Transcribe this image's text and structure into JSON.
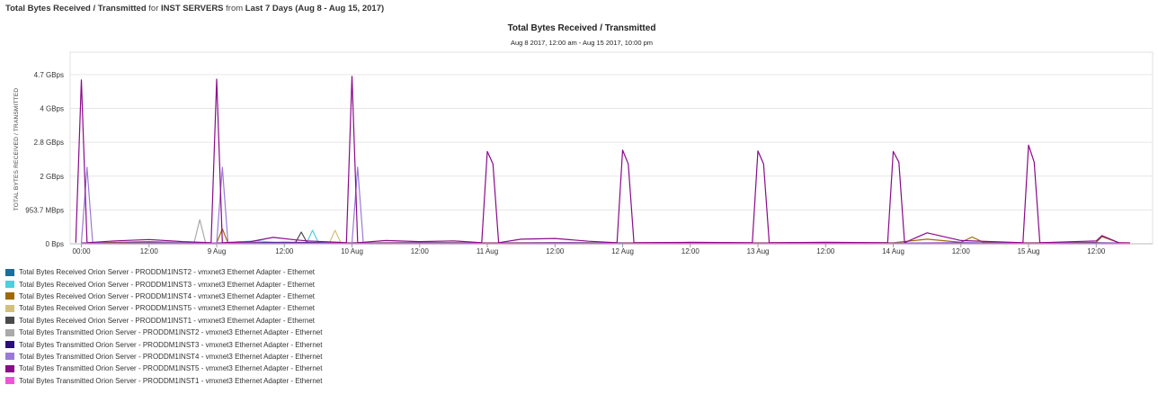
{
  "header": {
    "title": "Total Bytes Received / Transmitted",
    "for_word": "for",
    "group": "INST SERVERS",
    "from_word": "from",
    "range": "Last 7 Days (Aug 8 - Aug 15, 2017)"
  },
  "chart_data": {
    "type": "line",
    "title": "Total Bytes Received / Transmitted",
    "subtitle": "Aug 8 2017, 12:00 am - Aug 15 2017, 10:00 pm",
    "ylabel": "TOTAL BYTES RECEIVED / TRANSMITTED",
    "y_ticks": [
      {
        "value": 0,
        "label": "0 Bps"
      },
      {
        "value": 953.7,
        "label": "953.7 MBps"
      },
      {
        "value": 1907.3,
        "label": "2 GBps"
      },
      {
        "value": 2861,
        "label": "2.8 GBps"
      },
      {
        "value": 3814.7,
        "label": "4 GBps"
      },
      {
        "value": 4768.4,
        "label": "4.7 GBps"
      }
    ],
    "ylim": [
      0,
      5400
    ],
    "y_unit": "MBps",
    "x_range_hours": [
      -2,
      190
    ],
    "x_ticks": [
      {
        "hour": 0,
        "label": "00:00"
      },
      {
        "hour": 12,
        "label": "12:00"
      },
      {
        "hour": 24,
        "label": "9 Aug"
      },
      {
        "hour": 36,
        "label": "12:00"
      },
      {
        "hour": 48,
        "label": "10 Aug"
      },
      {
        "hour": 60,
        "label": "12:00"
      },
      {
        "hour": 72,
        "label": "11 Aug"
      },
      {
        "hour": 84,
        "label": "12:00"
      },
      {
        "hour": 96,
        "label": "12 Aug"
      },
      {
        "hour": 108,
        "label": "12:00"
      },
      {
        "hour": 120,
        "label": "13 Aug"
      },
      {
        "hour": 132,
        "label": "12:00"
      },
      {
        "hour": 144,
        "label": "14 Aug"
      },
      {
        "hour": 156,
        "label": "12:00"
      },
      {
        "hour": 168,
        "label": "15 Aug"
      },
      {
        "hour": 180,
        "label": "12:00"
      }
    ],
    "grid": "horizontal",
    "legend_position": "bottom",
    "series": [
      {
        "name": "Total Bytes Received Orion Server - PRODDM1INST2 - vmxnet3 Ethernet Adapter - Ethernet",
        "color": "#1a6e9e",
        "points": [
          [
            0,
            20
          ],
          [
            12,
            20
          ],
          [
            24,
            10
          ],
          [
            36,
            20
          ],
          [
            48,
            10
          ],
          [
            60,
            20
          ],
          [
            72,
            10
          ],
          [
            84,
            20
          ],
          [
            96,
            10
          ],
          [
            108,
            20
          ],
          [
            120,
            10
          ],
          [
            132,
            20
          ],
          [
            144,
            10
          ],
          [
            156,
            20
          ],
          [
            168,
            10
          ],
          [
            180,
            20
          ],
          [
            186,
            10
          ]
        ]
      },
      {
        "name": "Total Bytes Received Orion Server - PRODDM1INST3 - vmxnet3 Ethernet Adapter - Ethernet",
        "color": "#4dcfe0",
        "points": [
          [
            0,
            10
          ],
          [
            12,
            20
          ],
          [
            24,
            20
          ],
          [
            31,
            80
          ],
          [
            36,
            20
          ],
          [
            40,
            40
          ],
          [
            41,
            380
          ],
          [
            42,
            40
          ],
          [
            48,
            20
          ],
          [
            60,
            20
          ],
          [
            72,
            20
          ],
          [
            84,
            20
          ],
          [
            96,
            20
          ],
          [
            108,
            20
          ],
          [
            120,
            20
          ],
          [
            132,
            20
          ],
          [
            144,
            20
          ],
          [
            156,
            20
          ],
          [
            168,
            20
          ],
          [
            180,
            20
          ],
          [
            186,
            20
          ]
        ]
      },
      {
        "name": "Total Bytes Received Orion Server - PRODDM1INST4 - vmxnet3 Ethernet Adapter - Ethernet",
        "color": "#a06a00",
        "points": [
          [
            0,
            20
          ],
          [
            12,
            60
          ],
          [
            20,
            20
          ],
          [
            24,
            20
          ],
          [
            25,
            420
          ],
          [
            26,
            20
          ],
          [
            36,
            30
          ],
          [
            48,
            30
          ],
          [
            60,
            30
          ],
          [
            72,
            30
          ],
          [
            84,
            30
          ],
          [
            96,
            30
          ],
          [
            108,
            30
          ],
          [
            120,
            30
          ],
          [
            132,
            30
          ],
          [
            144,
            30
          ],
          [
            150,
            130
          ],
          [
            156,
            40
          ],
          [
            158,
            190
          ],
          [
            160,
            40
          ],
          [
            168,
            30
          ],
          [
            180,
            40
          ],
          [
            181,
            200
          ],
          [
            184,
            30
          ],
          [
            186,
            30
          ]
        ]
      },
      {
        "name": "Total Bytes Received Orion Server - PRODDM1INST5 - vmxnet3 Ethernet Adapter - Ethernet",
        "color": "#d4c07a",
        "points": [
          [
            0,
            10
          ],
          [
            12,
            20
          ],
          [
            24,
            10
          ],
          [
            28,
            60
          ],
          [
            36,
            20
          ],
          [
            44,
            30
          ],
          [
            45,
            380
          ],
          [
            46,
            30
          ],
          [
            48,
            20
          ],
          [
            60,
            20
          ],
          [
            72,
            20
          ],
          [
            84,
            20
          ],
          [
            96,
            20
          ],
          [
            108,
            20
          ],
          [
            120,
            20
          ],
          [
            132,
            20
          ],
          [
            144,
            20
          ],
          [
            156,
            20
          ],
          [
            168,
            20
          ],
          [
            180,
            20
          ],
          [
            186,
            10
          ]
        ]
      },
      {
        "name": "Total Bytes Received Orion Server - PRODDM1INST1 - vmxnet3 Ethernet Adapter - Ethernet",
        "color": "#4a4a4a",
        "points": [
          [
            0,
            10
          ],
          [
            12,
            10
          ],
          [
            24,
            10
          ],
          [
            36,
            10
          ],
          [
            38,
            40
          ],
          [
            39,
            330
          ],
          [
            40,
            40
          ],
          [
            48,
            10
          ],
          [
            60,
            10
          ],
          [
            72,
            10
          ],
          [
            84,
            10
          ],
          [
            96,
            10
          ],
          [
            108,
            10
          ],
          [
            120,
            10
          ],
          [
            132,
            10
          ],
          [
            144,
            10
          ],
          [
            156,
            10
          ],
          [
            168,
            10
          ],
          [
            180,
            10
          ],
          [
            186,
            10
          ]
        ]
      },
      {
        "name": "Total Bytes Transmitted Orion Server - PRODDM1INST2 - vmxnet3 Ethernet Adapter - Ethernet",
        "color": "#aaaaaa",
        "points": [
          [
            0,
            10
          ],
          [
            12,
            30
          ],
          [
            20,
            40
          ],
          [
            21,
            680
          ],
          [
            22,
            40
          ],
          [
            24,
            10
          ],
          [
            36,
            20
          ],
          [
            48,
            10
          ],
          [
            60,
            20
          ],
          [
            72,
            10
          ],
          [
            84,
            20
          ],
          [
            96,
            10
          ],
          [
            108,
            20
          ],
          [
            120,
            10
          ],
          [
            132,
            20
          ],
          [
            144,
            10
          ],
          [
            156,
            20
          ],
          [
            168,
            10
          ],
          [
            180,
            20
          ],
          [
            186,
            10
          ]
        ]
      },
      {
        "name": "Total Bytes Transmitted Orion Server - PRODDM1INST3 - vmxnet3 Ethernet Adapter - Ethernet",
        "color": "#2a0f78",
        "points": [
          [
            0,
            20
          ],
          [
            12,
            30
          ],
          [
            24,
            20
          ],
          [
            36,
            40
          ],
          [
            48,
            20
          ],
          [
            60,
            30
          ],
          [
            72,
            20
          ],
          [
            84,
            30
          ],
          [
            96,
            20
          ],
          [
            108,
            30
          ],
          [
            120,
            20
          ],
          [
            132,
            30
          ],
          [
            144,
            20
          ],
          [
            156,
            30
          ],
          [
            168,
            20
          ],
          [
            180,
            30
          ],
          [
            186,
            20
          ]
        ]
      },
      {
        "name": "Total Bytes Transmitted Orion Server - PRODDM1INST4 - vmxnet3 Ethernet Adapter - Ethernet",
        "color": "#9a7ad8",
        "points": [
          [
            0,
            20
          ],
          [
            1,
            2160
          ],
          [
            2,
            20
          ],
          [
            12,
            20
          ],
          [
            24,
            20
          ],
          [
            25,
            2160
          ],
          [
            26,
            20
          ],
          [
            36,
            20
          ],
          [
            48,
            20
          ],
          [
            49,
            2160
          ],
          [
            50,
            20
          ],
          [
            60,
            20
          ],
          [
            72,
            20
          ],
          [
            84,
            20
          ],
          [
            96,
            20
          ],
          [
            108,
            20
          ],
          [
            120,
            20
          ],
          [
            132,
            20
          ],
          [
            144,
            20
          ],
          [
            156,
            20
          ],
          [
            168,
            20
          ],
          [
            180,
            20
          ],
          [
            186,
            20
          ]
        ]
      },
      {
        "name": "Total Bytes Transmitted Orion Server - PRODDM1INST5 - vmxnet3 Ethernet Adapter - Ethernet",
        "color": "#8a0a8a",
        "points": [
          [
            -1,
            30
          ],
          [
            0,
            4620
          ],
          [
            1,
            30
          ],
          [
            6,
            80
          ],
          [
            12,
            120
          ],
          [
            18,
            60
          ],
          [
            23,
            30
          ],
          [
            24,
            4640
          ],
          [
            25,
            30
          ],
          [
            30,
            60
          ],
          [
            34,
            180
          ],
          [
            38,
            110
          ],
          [
            40,
            80
          ],
          [
            47,
            30
          ],
          [
            48,
            4720
          ],
          [
            49,
            30
          ],
          [
            54,
            90
          ],
          [
            60,
            60
          ],
          [
            66,
            80
          ],
          [
            71,
            30
          ],
          [
            72,
            2600
          ],
          [
            73,
            2250
          ],
          [
            74,
            30
          ],
          [
            78,
            130
          ],
          [
            84,
            150
          ],
          [
            90,
            70
          ],
          [
            95,
            30
          ],
          [
            96,
            2640
          ],
          [
            97,
            2250
          ],
          [
            98,
            30
          ],
          [
            108,
            40
          ],
          [
            119,
            30
          ],
          [
            120,
            2620
          ],
          [
            121,
            2250
          ],
          [
            122,
            30
          ],
          [
            132,
            40
          ],
          [
            143,
            30
          ],
          [
            144,
            2600
          ],
          [
            145,
            2300
          ],
          [
            146,
            30
          ],
          [
            150,
            310
          ],
          [
            156,
            90
          ],
          [
            167,
            30
          ],
          [
            168,
            2780
          ],
          [
            169,
            2300
          ],
          [
            170,
            30
          ],
          [
            180,
            80
          ],
          [
            181,
            230
          ],
          [
            184,
            30
          ],
          [
            186,
            20
          ]
        ]
      },
      {
        "name": "Total Bytes Transmitted Orion Server - PRODDM1INST1 - vmxnet3 Ethernet Adapter - Ethernet",
        "color": "#ee55d6",
        "points": [
          [
            0,
            10
          ],
          [
            12,
            10
          ],
          [
            24,
            10
          ],
          [
            36,
            10
          ],
          [
            48,
            10
          ],
          [
            60,
            10
          ],
          [
            72,
            10
          ],
          [
            84,
            10
          ],
          [
            96,
            10
          ],
          [
            108,
            10
          ],
          [
            120,
            10
          ],
          [
            132,
            10
          ],
          [
            144,
            10
          ],
          [
            156,
            10
          ],
          [
            168,
            10
          ],
          [
            180,
            10
          ],
          [
            186,
            10
          ]
        ]
      }
    ]
  }
}
